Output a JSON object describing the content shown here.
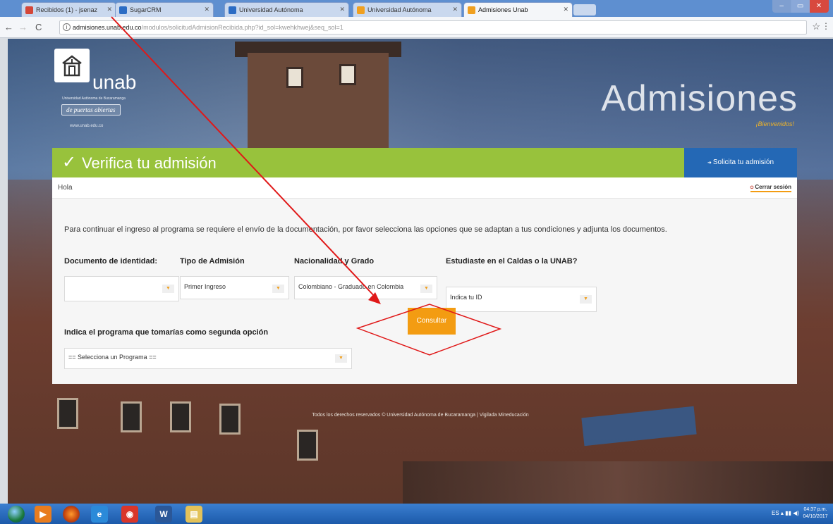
{
  "browser": {
    "tabs": [
      {
        "label": "Recibidos (1) - jsenaz",
        "color": "#d44638"
      },
      {
        "label": "SugarCRM",
        "color": "#2b6cc4"
      },
      {
        "label": "Universidad Autónoma",
        "color": "#2b6cc4"
      },
      {
        "label": "Universidad Autónoma",
        "color": "#f0a020"
      },
      {
        "label": "Admisiones Unab",
        "color": "#f0a020"
      }
    ],
    "url_host": "admisiones.unab.edu.co",
    "url_path": "/modulos/solicitudAdmisionRecibida.php?id_sol=kwehkhwej&seq_sol=1"
  },
  "brand": {
    "logo_text": "unab",
    "university": "Universidad Autónoma de Bucaramanga",
    "slogan": "de puertas abiertas",
    "site": "www.unab.edu.co"
  },
  "hero": {
    "title": "Admisiones",
    "subtitle": "¡Bienvenidos!"
  },
  "panel": {
    "title": "Verifica tu admisión",
    "apply_label": "Solicita tu admisión",
    "greeting": "Hola",
    "logout_label": "Cerrar sesión",
    "instructions": "Para continuar el ingreso al programa se requiere el envío de la documentación, por favor selecciona las opciones que se adaptan a tus condiciones y adjunta los documentos.",
    "fields": {
      "document_label": "Documento de identidad:",
      "document_value": "",
      "admission_label": "Tipo de Admisión",
      "admission_value": "Primer Ingreso",
      "nationality_label": "Nacionalidad y Grado",
      "nationality_value": "Colombiano - Graduado en Colombia",
      "studied_label": "Estudiaste en el Caldas o la UNAB?",
      "studied_value": "Indica tu ID",
      "second_label": "Indica el programa que tomarías como segunda opción",
      "second_value": "== Selecciona un Programa =="
    },
    "consult_label": "Consultar"
  },
  "footer": {
    "text": "Todos los derechos reservados © Universidad Autónoma de Bucaramanga | Vigilada Mineducación"
  },
  "taskbar": {
    "tray_lang": "ES",
    "time": "04:37 p.m.",
    "date": "04/10/2017"
  },
  "annotation_color": "#e01818"
}
